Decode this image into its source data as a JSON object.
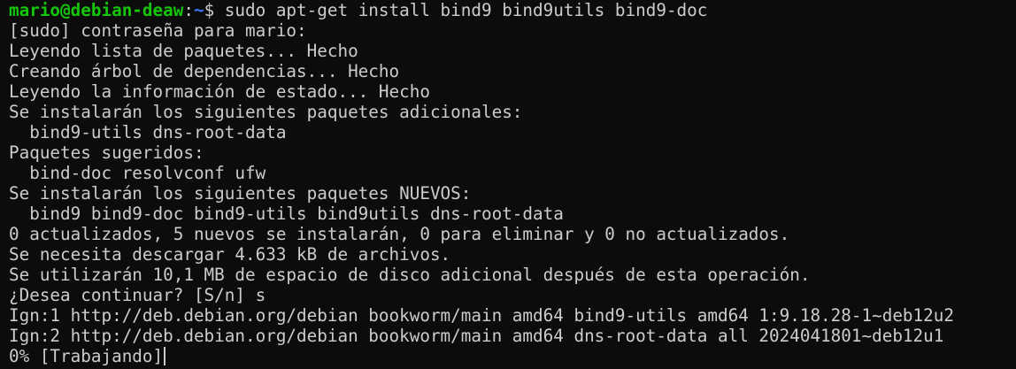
{
  "colors": {
    "background": "#0c0c0c",
    "foreground": "#cccccc",
    "prompt_user": "#16c60c",
    "prompt_path": "#3b78ff"
  },
  "prompt": {
    "user_host": "mario@debian-deaw",
    "separator": ":",
    "path": "~",
    "symbol": "$ ",
    "command": "sudo apt-get install bind9 bind9utils bind9-doc"
  },
  "output_lines": [
    "[sudo] contraseña para mario:",
    "Leyendo lista de paquetes... Hecho",
    "Creando árbol de dependencias... Hecho",
    "Leyendo la información de estado... Hecho",
    "Se instalarán los siguientes paquetes adicionales:",
    "  bind9-utils dns-root-data",
    "Paquetes sugeridos:",
    "  bind-doc resolvconf ufw",
    "Se instalarán los siguientes paquetes NUEVOS:",
    "  bind9 bind9-doc bind9-utils bind9utils dns-root-data",
    "0 actualizados, 5 nuevos se instalarán, 0 para eliminar y 0 no actualizados.",
    "Se necesita descargar 4.633 kB de archivos.",
    "Se utilizarán 10,1 MB de espacio de disco adicional después de esta operación.",
    "¿Desea continuar? [S/n] s",
    "Ign:1 http://deb.debian.org/debian bookworm/main amd64 bind9-utils amd64 1:9.18.28-1~deb12u2",
    "Ign:2 http://deb.debian.org/debian bookworm/main amd64 dns-root-data all 2024041801~deb12u1"
  ],
  "progress_line": "0% [Trabajando]"
}
